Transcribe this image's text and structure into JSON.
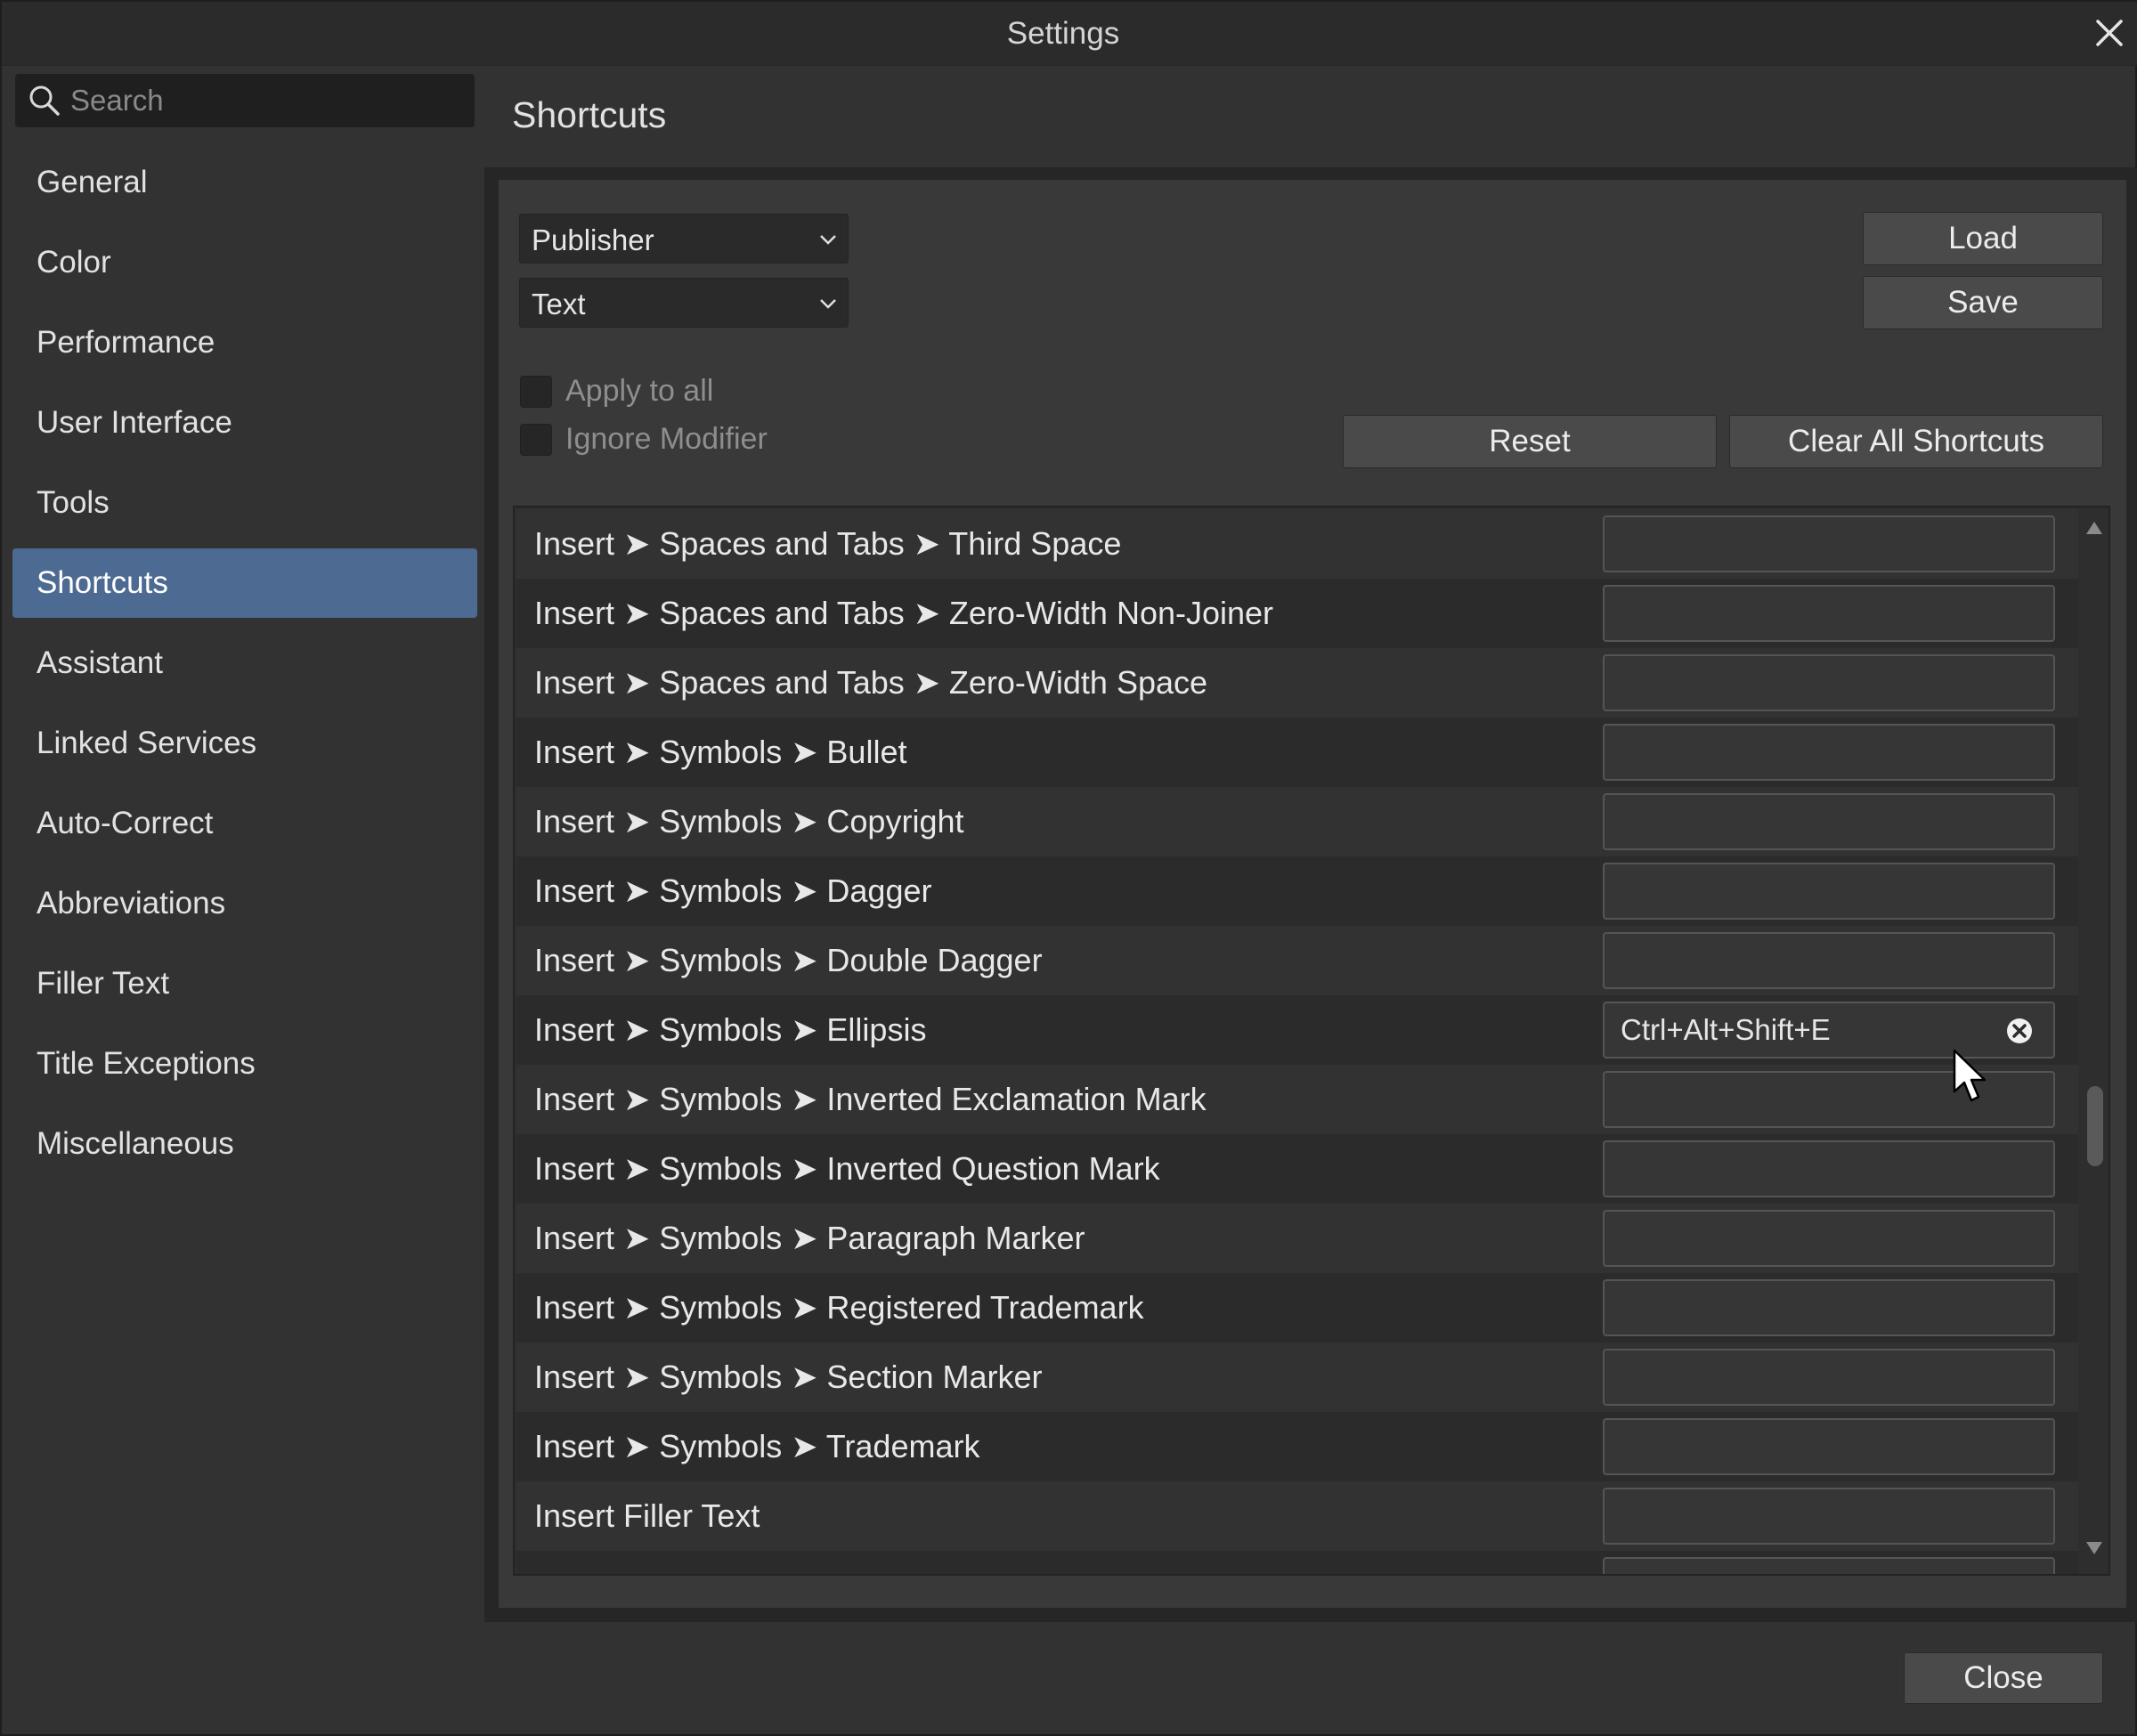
{
  "window": {
    "title": "Settings"
  },
  "search": {
    "placeholder": "Search",
    "value": ""
  },
  "sidebar": {
    "items": [
      {
        "label": "General",
        "active": false
      },
      {
        "label": "Color",
        "active": false
      },
      {
        "label": "Performance",
        "active": false
      },
      {
        "label": "User Interface",
        "active": false
      },
      {
        "label": "Tools",
        "active": false
      },
      {
        "label": "Shortcuts",
        "active": true
      },
      {
        "label": "Assistant",
        "active": false
      },
      {
        "label": "Linked Services",
        "active": false
      },
      {
        "label": "Auto-Correct",
        "active": false
      },
      {
        "label": "Abbreviations",
        "active": false
      },
      {
        "label": "Filler Text",
        "active": false
      },
      {
        "label": "Title Exceptions",
        "active": false
      },
      {
        "label": "Miscellaneous",
        "active": false
      }
    ]
  },
  "main": {
    "title": "Shortcuts",
    "app_select": "Publisher",
    "category_select": "Text",
    "load_label": "Load",
    "save_label": "Save",
    "apply_to_all_label": "Apply to all",
    "ignore_modifier_label": "Ignore Modifier",
    "reset_label": "Reset",
    "clear_all_label": "Clear All Shortcuts"
  },
  "shortcuts": {
    "rows": [
      {
        "label": "Insert ➤ Spaces and Tabs ➤ Third Space",
        "shortcut": ""
      },
      {
        "label": "Insert ➤ Spaces and Tabs ➤ Zero-Width Non-Joiner",
        "shortcut": ""
      },
      {
        "label": "Insert ➤ Spaces and Tabs ➤ Zero-Width Space",
        "shortcut": ""
      },
      {
        "label": "Insert ➤ Symbols ➤ Bullet",
        "shortcut": ""
      },
      {
        "label": "Insert ➤ Symbols ➤ Copyright",
        "shortcut": ""
      },
      {
        "label": "Insert ➤ Symbols ➤ Dagger",
        "shortcut": ""
      },
      {
        "label": "Insert ➤ Symbols ➤ Double Dagger",
        "shortcut": ""
      },
      {
        "label": "Insert ➤ Symbols ➤ Ellipsis",
        "shortcut": "Ctrl+Alt+Shift+E"
      },
      {
        "label": "Insert ➤ Symbols ➤ Inverted Exclamation Mark",
        "shortcut": ""
      },
      {
        "label": "Insert ➤ Symbols ➤ Inverted Question Mark",
        "shortcut": ""
      },
      {
        "label": "Insert ➤ Symbols ➤ Paragraph Marker",
        "shortcut": ""
      },
      {
        "label": "Insert ➤ Symbols ➤ Registered Trademark",
        "shortcut": ""
      },
      {
        "label": "Insert ➤ Symbols ➤ Section Marker",
        "shortcut": ""
      },
      {
        "label": "Insert ➤ Symbols ➤ Trademark",
        "shortcut": ""
      },
      {
        "label": "Insert Filler Text",
        "shortcut": ""
      },
      {
        "label": "",
        "shortcut": ""
      }
    ]
  },
  "footer": {
    "close_label": "Close"
  },
  "colors": {
    "accent": "#4c6a92",
    "background": "#323232",
    "panel": "#393939"
  }
}
